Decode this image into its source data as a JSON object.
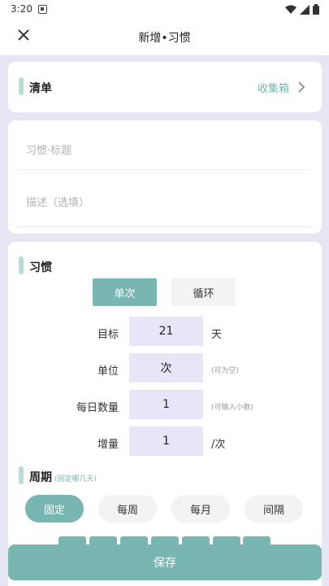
{
  "status_bar": {
    "time": "3:20"
  },
  "header": {
    "title": "新增•习惯"
  },
  "list_card": {
    "label": "清单",
    "value": "收集箱"
  },
  "inputs": {
    "title_placeholder": "习惯·标题",
    "desc_placeholder": "描述（选填）"
  },
  "habit": {
    "label": "习惯",
    "modes": [
      "单次",
      "循环"
    ],
    "active_mode": "单次",
    "rows": [
      {
        "label": "目标",
        "value": "21",
        "unit": "天",
        "unit_style": "big"
      },
      {
        "label": "单位",
        "value": "次",
        "unit": "(可为空)",
        "unit_style": "small"
      },
      {
        "label": "每日数量",
        "value": "1",
        "unit": "(可输入小数)",
        "unit_style": "small"
      },
      {
        "label": "增量",
        "value": "1",
        "unit": "/次",
        "unit_style": "big"
      }
    ]
  },
  "period": {
    "label": "周期",
    "sub": "(固定哪几天)",
    "options": [
      "固定",
      "每周",
      "每月",
      "间隔"
    ],
    "active": "固定"
  },
  "save_label": "保存",
  "colors": {
    "accent": "#79b6b1",
    "accent_light": "#b9dcd9",
    "bg": "#e6e6f4",
    "input_bg": "#e6e6f8"
  }
}
